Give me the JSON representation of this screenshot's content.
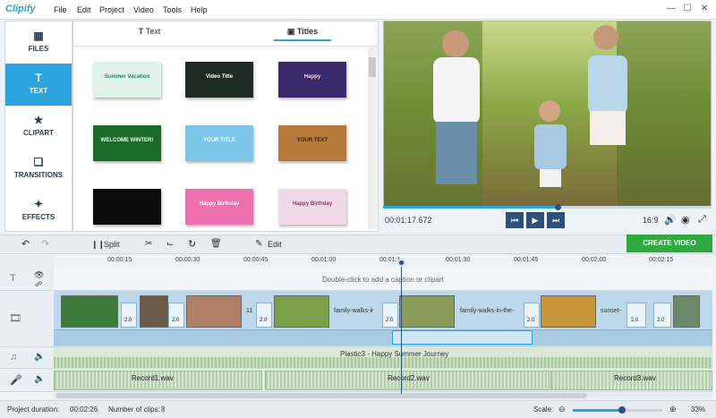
{
  "app": {
    "title": "Clipify"
  },
  "menu": [
    "File",
    "Edit",
    "Project",
    "Video",
    "Tools",
    "Help"
  ],
  "sidebar": {
    "items": [
      {
        "label": "FILES",
        "icon": "image-icon"
      },
      {
        "label": "TEXT",
        "icon": "text-icon"
      },
      {
        "label": "CLIPART",
        "icon": "star-icon"
      },
      {
        "label": "TRANSITIONS",
        "icon": "transitions-icon"
      },
      {
        "label": "EFFECTS",
        "icon": "magic-wand-icon"
      }
    ]
  },
  "text_panel": {
    "tabs": [
      {
        "label": "Text"
      },
      {
        "label": "Titles"
      }
    ],
    "thumbs": [
      {
        "text": "Summer Vacation",
        "bg": "#dff3ea",
        "fg": "#1e8a6a"
      },
      {
        "text": "Video Title",
        "bg": "#1f2a25",
        "fg": "#ffffff"
      },
      {
        "text": "Happy",
        "bg": "#3a2a6b",
        "fg": "#ffd6ef"
      },
      {
        "text": "WELCOME WINTER!",
        "bg": "#1d6b2a",
        "fg": "#e8ffe8"
      },
      {
        "text": "YOUR TITLE",
        "bg": "#7cc7ea",
        "fg": "#ffffff"
      },
      {
        "text": "YOUR TEXT",
        "bg": "#b87a3a",
        "fg": "#222222"
      },
      {
        "text": "",
        "bg": "#0c0c0c",
        "fg": "#cccccc"
      },
      {
        "text": "Happy Birthday",
        "bg": "#ee6fae",
        "fg": "#ffffff"
      },
      {
        "text": "Happy Birthday",
        "bg": "#f0d9e6",
        "fg": "#8a3b6a"
      }
    ]
  },
  "player": {
    "time": "00:01:17.672",
    "progress": 0.53,
    "aspect": "16:9"
  },
  "toolbar": {
    "split": "Split",
    "edit": "Edit",
    "create": "CREATE VIDEO"
  },
  "ruler": [
    "00:00:15",
    "00:00:30",
    "00:00:45",
    "00:01:00",
    "00:01:1",
    "00:01:30",
    "00:01:45",
    "00:02:00",
    "00:02:15"
  ],
  "timeline": {
    "caption_hint": "Double-click to add a caption or clipart",
    "clips": [
      {
        "label": "",
        "color": "#3d7a3a"
      },
      {
        "label": "",
        "color": "#6b5a48"
      },
      {
        "label": "",
        "color": "#b08068"
      },
      {
        "label": "11",
        "color": ""
      },
      {
        "label": "",
        "color": "#7aa04a"
      },
      {
        "label": "family-walks-ir",
        "color": ""
      },
      {
        "label": "",
        "color": "#8a9c5a"
      },
      {
        "label": "family-walks-in-the-",
        "color": ""
      },
      {
        "label": "",
        "color": "#c8963a"
      },
      {
        "label": "sunset-",
        "color": ""
      },
      {
        "label": "",
        "color": "#6a8a6a"
      }
    ],
    "clip_durations": [
      "2.0",
      "2.0",
      "2.0",
      "2.0",
      "2.0",
      "2.0",
      "2.0",
      "2.0",
      "2.0"
    ],
    "music": "Plastic3 - Happy Summer Journey",
    "records": [
      "Record1.wav",
      "Record2.wav",
      "Record3.wav"
    ]
  },
  "status": {
    "duration_label": "Project duration:",
    "duration": "00:02:26",
    "clips_label": "Number of clips:",
    "clips": "8",
    "scale_label": "Scale:",
    "scale": "33%"
  },
  "colors": {
    "accent": "#2ba3dd",
    "create": "#2eaa3f",
    "player": "#2d4f7a"
  }
}
